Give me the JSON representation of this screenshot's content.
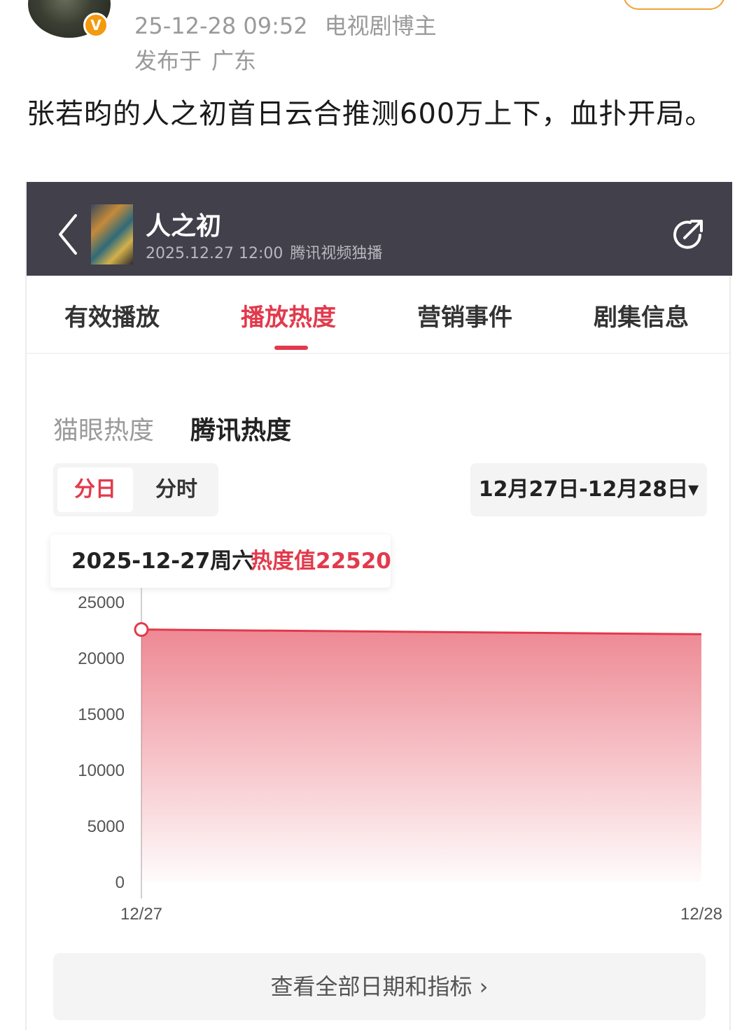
{
  "post": {
    "timestamp": "25-12-28 09:52",
    "author_tag": "电视剧博主",
    "location_prefix": "发布于",
    "location": "广东",
    "badge": "V",
    "text": "张若昀的人之初首日云合推测600万上下，血扑开局。"
  },
  "app": {
    "title": "人之初",
    "air_time": "2025.12.27 12:00",
    "platform": "腾讯视频独播",
    "tabs": [
      "有效播放",
      "播放热度",
      "营销事件",
      "剧集信息"
    ],
    "active_tab": "播放热度",
    "subtabs": [
      "猫眼热度",
      "腾讯热度"
    ],
    "active_subtab": "腾讯热度",
    "segments": [
      "分日",
      "分时"
    ],
    "active_segment": "分日",
    "date_range": "12月27日-12月28日▾",
    "tooltip": {
      "date": "2025-12-27周六",
      "heat": "热度值22520"
    },
    "more_button": "查看全部日期和指标 ›",
    "colors": {
      "accent": "#e23a4c",
      "header_bg": "#41404b",
      "verified": "#f39a0e"
    },
    "icons": [
      "chevron-left-icon",
      "share-icon",
      "verified-icon"
    ]
  },
  "chart_data": {
    "type": "area",
    "x": [
      "12/27",
      "12/28"
    ],
    "series": [
      {
        "values": [
          22520,
          22100
        ]
      }
    ],
    "y_ticks": [
      "25000",
      "20000",
      "15000",
      "10000",
      "5000",
      "0"
    ],
    "ylim": [
      0,
      25000
    ],
    "highlight_index": 0,
    "grid": false,
    "color": "#e23a4c"
  }
}
